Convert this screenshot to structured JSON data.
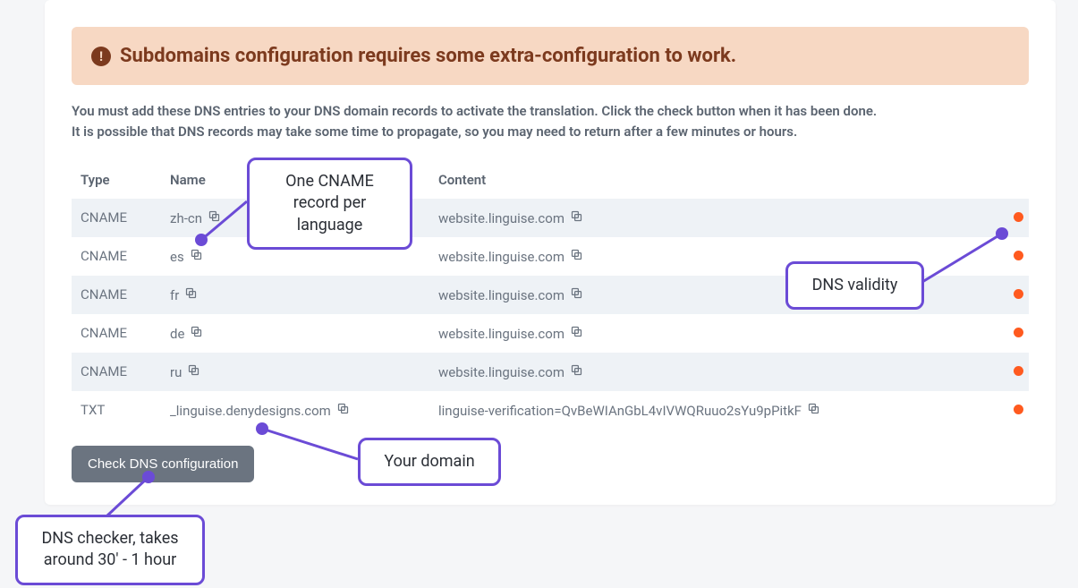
{
  "alert": {
    "title": "Subdomains configuration requires some extra-configuration to work."
  },
  "instructions": {
    "line1": "You must add these DNS entries to your DNS domain records to activate the translation. Click the check button when it has been done.",
    "line2": "It is possible that DNS records may take some time to propagate, so you may need to return after a few minutes or hours."
  },
  "table": {
    "headers": {
      "type": "Type",
      "name": "Name",
      "content": "Content"
    },
    "rows": [
      {
        "type": "CNAME",
        "name": "zh-cn",
        "content": "website.linguise.com",
        "valid": false
      },
      {
        "type": "CNAME",
        "name": "es",
        "content": "website.linguise.com",
        "valid": false
      },
      {
        "type": "CNAME",
        "name": "fr",
        "content": "website.linguise.com",
        "valid": false
      },
      {
        "type": "CNAME",
        "name": "de",
        "content": "website.linguise.com",
        "valid": false
      },
      {
        "type": "CNAME",
        "name": "ru",
        "content": "website.linguise.com",
        "valid": false
      },
      {
        "type": "TXT",
        "name": "_linguise.denydesigns.com",
        "content": "linguise-verification=QvBeWIAnGbL4vIVWQRuuo2sYu9pPitkF",
        "valid": false
      }
    ]
  },
  "button": {
    "check_label": "Check DNS configuration"
  },
  "annotations": {
    "cname_per_lang": "One CNAME record per language",
    "dns_validity": "DNS validity",
    "your_domain": "Your domain",
    "dns_checker": "DNS checker, takes around 30' - 1 hour"
  }
}
